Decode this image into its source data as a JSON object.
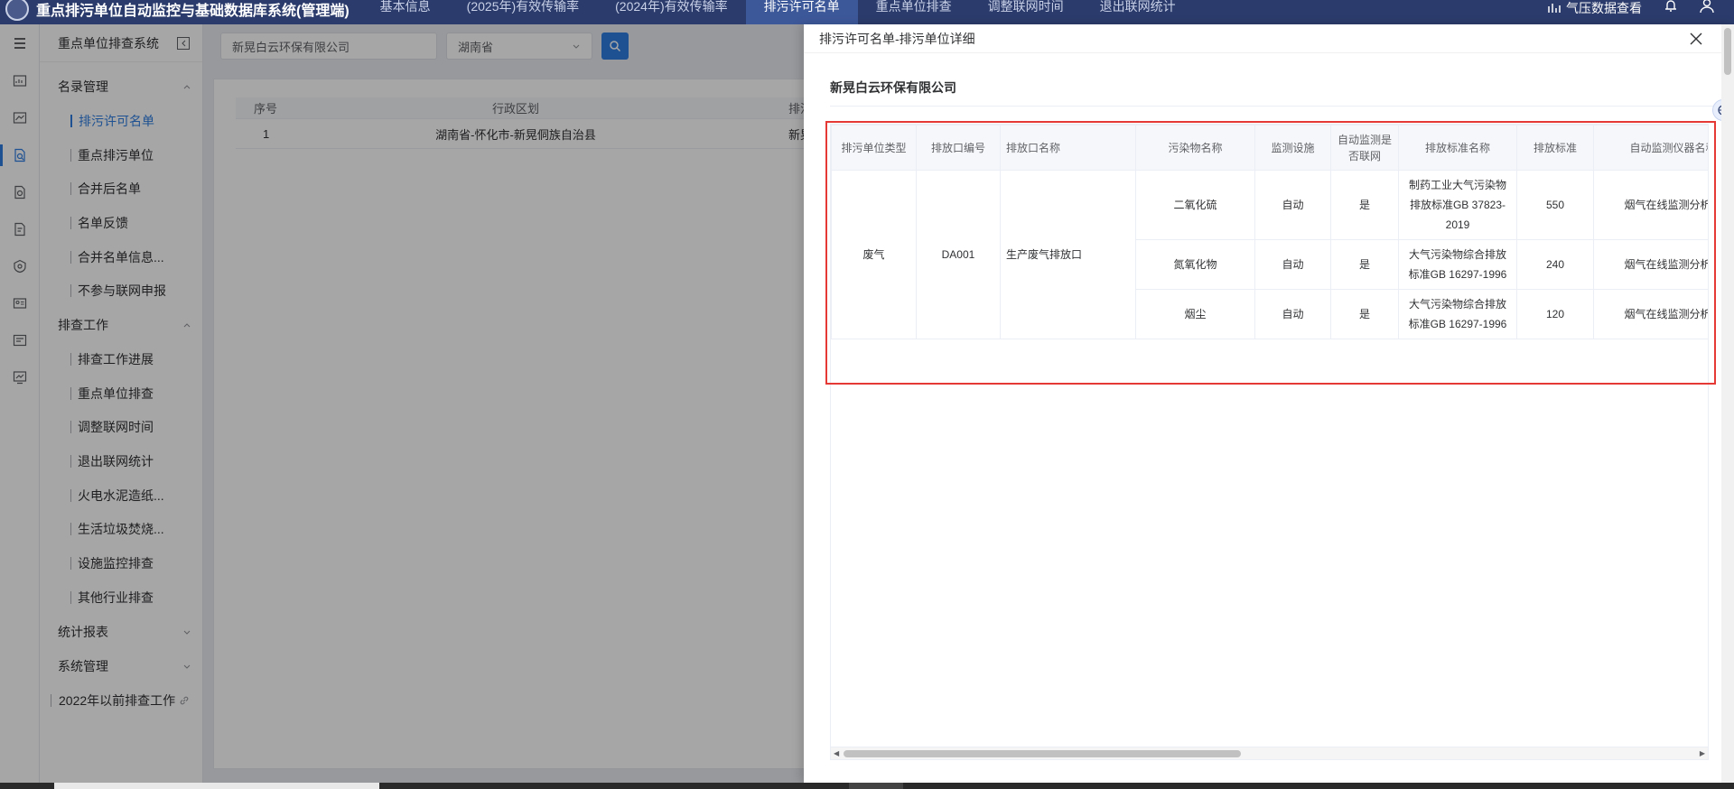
{
  "app": {
    "title": "重点排污单位自动监控与基础数据库系统(管理端)"
  },
  "top_nav": {
    "items": [
      "基本信息",
      "(2025年)有效传输率",
      "(2024年)有效传输率",
      "排污许可名单",
      "重点单位排查",
      "调整联网时间",
      "退出联网统计"
    ],
    "active_index": 3,
    "right_label": "气压数据查看",
    "icons": [
      "chart-bars-icon",
      "bell-icon",
      "user-icon"
    ]
  },
  "rail": {
    "icons": [
      "dashboard-icon",
      "statistics-icon",
      "search-doc-icon",
      "inspect-doc-icon",
      "review-doc-icon",
      "settings-shield-icon",
      "id-card-icon",
      "list-check-icon",
      "monitor-chart-icon"
    ],
    "active_index": 2
  },
  "sidebar": {
    "title": "重点单位排查系统",
    "groups": [
      {
        "label": "名录管理",
        "expanded": true,
        "items": [
          "排污许可名单",
          "重点排污单位",
          "合并后名单",
          "名单反馈",
          "合并名单信息...",
          "不参与联网申报"
        ]
      },
      {
        "label": "排查工作",
        "expanded": true,
        "items": [
          "排查工作进展",
          "重点单位排查",
          "调整联网时间",
          "退出联网统计",
          "火电水泥造纸...",
          "生活垃圾焚烧...",
          "设施监控排查",
          "其他行业排查"
        ]
      },
      {
        "label": "统计报表",
        "expanded": false,
        "items": []
      },
      {
        "label": "系统管理",
        "expanded": false,
        "items": []
      }
    ],
    "active_item": "排污许可名单",
    "extra_item": "2022年以前排查工作"
  },
  "search": {
    "company_value": "新晃白云环保有限公司",
    "province_value": "湖南省"
  },
  "background_table": {
    "headers": [
      "序号",
      "行政区划",
      "排污单位名"
    ],
    "rows": [
      [
        "1",
        "湖南省-怀化市-新晃侗族自治县",
        "新晃白云环"
      ]
    ]
  },
  "dialog": {
    "title": "排污许可名单-排污单位详细",
    "company": "新晃白云环保有限公司",
    "table": {
      "headers": [
        "排污单位类型",
        "排放口编号",
        "排放口名称",
        "污染物名称",
        "监测设施",
        "自动监测是否联网",
        "排放标准名称",
        "排放标准",
        "自动监测仪器名称"
      ],
      "unit_type": "废气",
      "outlet_code": "DA001",
      "outlet_name": "生产废气排放口",
      "rows": [
        [
          "二氧化硫",
          "自动",
          "是",
          "制药工业大气污染物排放标准GB 37823-2019",
          "550",
          "烟气在线监测分析仪"
        ],
        [
          "氮氧化物",
          "自动",
          "是",
          "大气污染物综合排放标准GB 16297-1996",
          "240",
          "烟气在线监测分析仪"
        ],
        [
          "烟尘",
          "自动",
          "是",
          "大气污染物综合排放标准GB 16297-1996",
          "120",
          "烟气在线监测分析仪"
        ]
      ]
    }
  },
  "colors": {
    "topbar": "#2b3b6b",
    "active_nav": "#3d5899",
    "accent": "#2f7de1",
    "highlight_box": "#e53935"
  }
}
